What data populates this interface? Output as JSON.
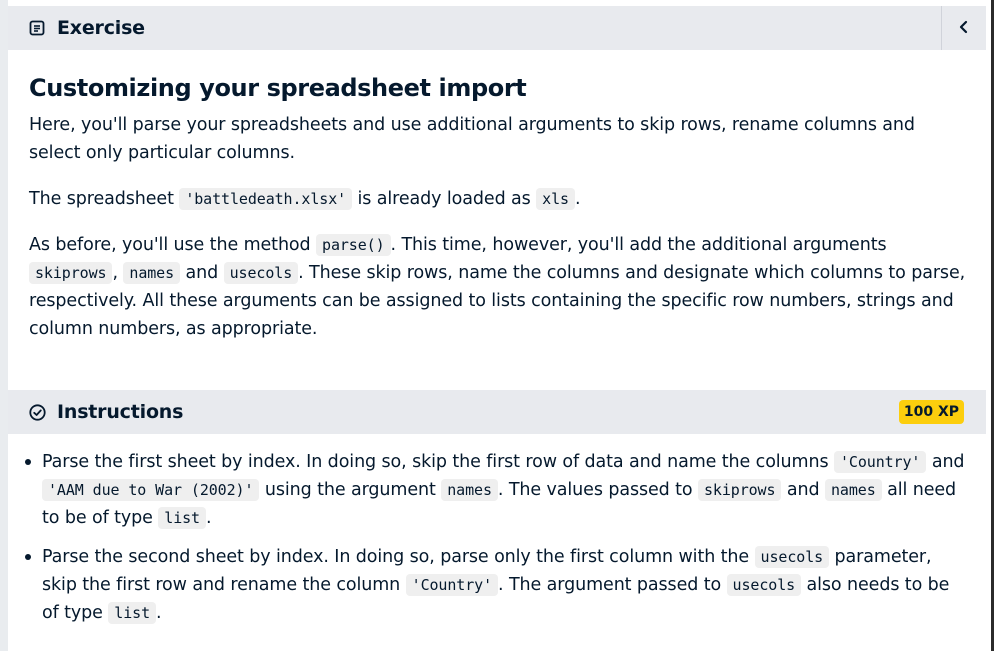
{
  "exercise": {
    "header_title": "Exercise",
    "title": "Customizing your spreadsheet import",
    "p1": "Here, you'll parse your spreadsheets and use additional arguments to skip rows, rename columns and select only particular columns.",
    "p2": {
      "t1": "The spreadsheet ",
      "c1": "'battledeath.xlsx'",
      "t2": " is already loaded as ",
      "c2": "xls",
      "t3": "."
    },
    "p3": {
      "t1": "As before, you'll use the method ",
      "c1": "parse()",
      "t2": ". This time, however, you'll add the additional arguments ",
      "c2": "skiprows",
      "t3": ", ",
      "c3": "names",
      "t4": " and ",
      "c4": "usecols",
      "t5": ". These skip rows, name the columns and designate which columns to parse, respectively. All these arguments can be assigned to lists containing the specific row numbers, strings and column numbers, as appropriate."
    }
  },
  "instructions": {
    "header_title": "Instructions",
    "xp": "100 XP",
    "item1": {
      "t1": "Parse the first sheet by index. In doing so, skip the first row of data and name the columns ",
      "c1": "'Country'",
      "t2": " and ",
      "c2": "'AAM due to War (2002)'",
      "t3": " using the argument ",
      "c3": "names",
      "t4": ". The values passed to ",
      "c4": "skiprows",
      "t5": " and ",
      "c5": "names",
      "t6": " all need to be of type ",
      "c6": "list",
      "t7": "."
    },
    "item2": {
      "t1": "Parse the second sheet by index. In doing so, parse only the first column with the ",
      "c1": "usecols",
      "t2": " parameter, skip the first row and rename the column ",
      "c2": "'Country'",
      "t3": ". The argument passed to ",
      "c3": "usecols",
      "t4": " also needs to be of type ",
      "c4": "list",
      "t5": "."
    }
  },
  "icons": {
    "exercise": "document-icon",
    "instructions": "check-circle-icon",
    "collapse": "chevron-left-icon"
  },
  "colors": {
    "text": "#05192d",
    "header_bg": "#e8eaee",
    "xp_badge": "#fcce0d",
    "code_bg": "#efefef"
  }
}
